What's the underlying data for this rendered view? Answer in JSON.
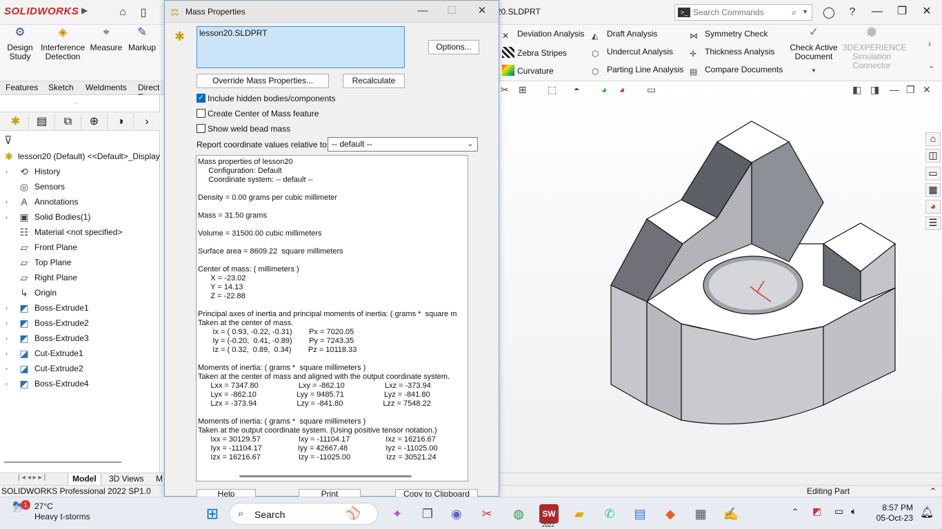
{
  "titlebar": {
    "app_brand": "SOLIDWORKS",
    "doc_title": "20.SLDPRT",
    "search_placeholder": "Search Commands"
  },
  "ribbon": {
    "big_buttons": [
      {
        "label": "Design\nStudy",
        "icon": "design-study-icon"
      },
      {
        "label": "Interference\nDetection",
        "icon": "interference-icon"
      },
      {
        "label": "Measure",
        "icon": "measure-icon"
      },
      {
        "label": "Markup",
        "icon": "markup-icon"
      }
    ],
    "tools_col1": [
      "Deviation Analysis",
      "Zebra Stripes",
      "Curvature"
    ],
    "tools_col2": [
      "Draft Analysis",
      "Undercut Analysis",
      "Parting Line Analysis"
    ],
    "tools_col3": [
      "Symmetry Check",
      "Thickness Analysis",
      "Compare Documents"
    ],
    "check_active": "Check Active\nDocument",
    "experience": "3DEXPERIENCE\nSimulation\nConnector"
  },
  "command_tabs": [
    "Features",
    "Sketch",
    "Weldments",
    "Direct E"
  ],
  "tree": {
    "root": "lesson20 (Default) <<Default>_Display",
    "items": [
      {
        "label": "History",
        "icon": "history-icon",
        "expand": true
      },
      {
        "label": "Sensors",
        "icon": "sensor-icon",
        "expand": false
      },
      {
        "label": "Annotations",
        "icon": "annotation-icon",
        "expand": true
      },
      {
        "label": "Solid Bodies(1)",
        "icon": "solid-bodies-icon",
        "expand": true
      },
      {
        "label": "Material <not specified>",
        "icon": "material-icon",
        "expand": false
      },
      {
        "label": "Front Plane",
        "icon": "plane-icon",
        "expand": false
      },
      {
        "label": "Top Plane",
        "icon": "plane-icon",
        "expand": false
      },
      {
        "label": "Right Plane",
        "icon": "plane-icon",
        "expand": false
      },
      {
        "label": "Origin",
        "icon": "origin-icon",
        "expand": false
      },
      {
        "label": "Boss-Extrude1",
        "icon": "extrude-icon",
        "expand": true
      },
      {
        "label": "Boss-Extrude2",
        "icon": "extrude-icon",
        "expand": true
      },
      {
        "label": "Boss-Extrude3",
        "icon": "extrude-icon",
        "expand": true
      },
      {
        "label": "Cut-Extrude1",
        "icon": "cut-icon",
        "expand": true
      },
      {
        "label": "Cut-Extrude2",
        "icon": "cut-icon",
        "expand": true
      },
      {
        "label": "Boss-Extrude4",
        "icon": "extrude-icon",
        "expand": true
      }
    ]
  },
  "bottom_tabs": [
    "Model",
    "3D Views",
    "M"
  ],
  "status": {
    "left": "SOLIDWORKS Professional 2022 SP1.0",
    "right": "Editing Part"
  },
  "dialog": {
    "title": "Mass Properties",
    "selection": "lesson20.SLDPRT",
    "options_btn": "Options...",
    "override_btn": "Override Mass Properties...",
    "recalc_btn": "Recalculate",
    "chk_hidden": "Include hidden bodies/components",
    "chk_hidden_on": true,
    "chk_com": "Create Center of Mass feature",
    "chk_weld": "Show weld bead mass",
    "coord_label": "Report coordinate values relative to:",
    "coord_value": "-- default --",
    "help_btn": "Help",
    "print_btn": "Print",
    "copy_btn": "Copy to Clipboard",
    "results": [
      "Mass properties of lesson20",
      "     Configuration: Default",
      "     Coordinate system: -- default --",
      "",
      "Density = 0.00 grams per cubic millimeter",
      "",
      "Mass = 31.50 grams",
      "",
      "Volume = 31500.00 cubic millimeters",
      "",
      "Surface area = 8609.22  square millimeters",
      "",
      "Center of mass: ( millimeters )",
      "      X = -23.02",
      "      Y = 14.13",
      "      Z = -22.88",
      "",
      "Principal axes of inertia and principal moments of inertia: ( grams *  square m",
      "Taken at the center of mass.",
      "       Ix = ( 0.93, -0.22, -0.31)        Px = 7020.05",
      "       Iy = (-0.20,  0.41, -0.89)        Py = 7243.35",
      "       Iz = ( 0.32,  0.89,  0.34)        Pz = 10118.33",
      "",
      "Moments of inertia: ( grams *  square millimeters )",
      "Taken at the center of mass and aligned with the output coordinate system.",
      "      Lxx = 7347.80                   Lxy = -862.10                   Lxz = -373.94",
      "      Lyx = -862.10                   Lyy = 9485.71                   Lyz = -841.80",
      "      Lzx = -373.94                   Lzy = -841.80                   Lzz = 7548.22",
      "",
      "Moments of inertia: ( grams *  square millimeters )",
      "Taken at the output coordinate system. (Using positive tensor notation.)",
      "      Ixx = 30129.57                  Ixy = -11104.17                 Ixz = 16216.67",
      "      Iyx = -11104.17                 Iyy = 42667.48                  Iyz = -11025.00",
      "      Izx = 16216.67                  Izy = -11025.00                 Izz = 30521.24"
    ]
  },
  "taskbar": {
    "temp": "27°C",
    "condition": "Heavy t-storms",
    "badge": "1",
    "search": "Search",
    "time": "8:57 PM",
    "date": "05-Oct-23",
    "sw_badge": "2022"
  },
  "colors": {
    "accent": "#0067c0",
    "selection": "#cce4f7",
    "brand_red": "#d22222"
  }
}
